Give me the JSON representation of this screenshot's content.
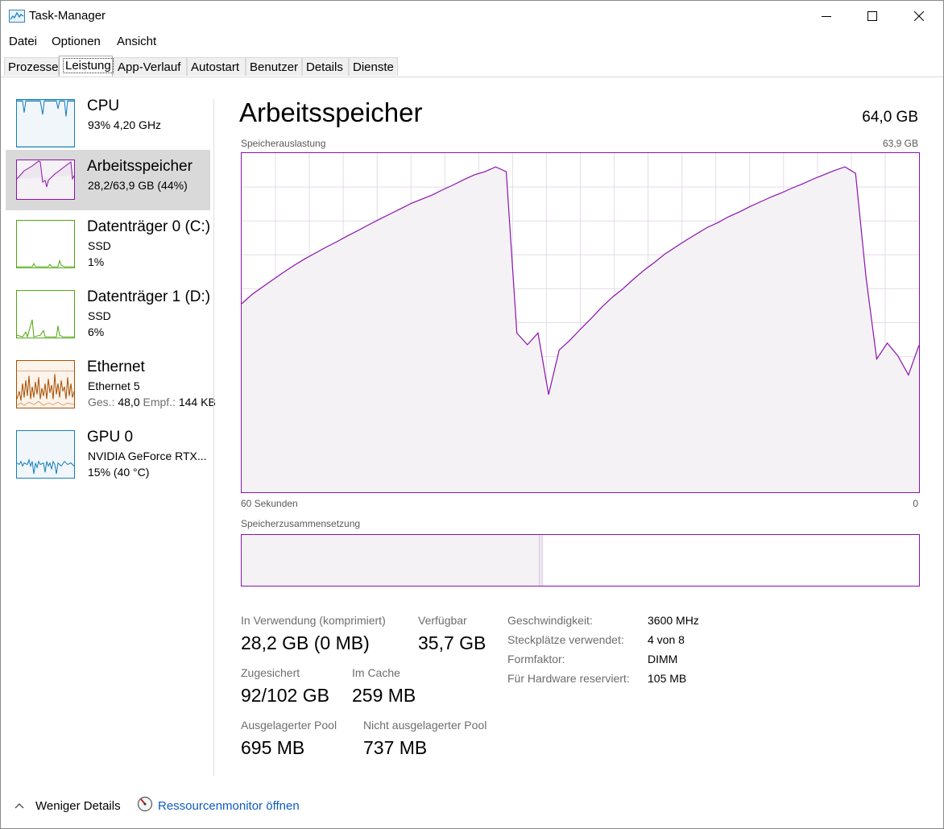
{
  "window": {
    "title": "Task-Manager"
  },
  "menu": [
    {
      "label": "Datei"
    },
    {
      "label": "Optionen"
    },
    {
      "label": "Ansicht"
    }
  ],
  "tabs": [
    {
      "label": "Prozesse"
    },
    {
      "label": "Leistung",
      "active": true
    },
    {
      "label": "App-Verlauf"
    },
    {
      "label": "Autostart"
    },
    {
      "label": "Benutzer"
    },
    {
      "label": "Details"
    },
    {
      "label": "Dienste"
    }
  ],
  "sidebar": {
    "items": [
      {
        "title": "CPU",
        "sub1": "93%  4,20 GHz",
        "color": "#117dbb"
      },
      {
        "title": "Arbeitsspeicher",
        "sub1": "28,2/63,9 GB (44%)",
        "color": "#8b12ae",
        "selected": true
      },
      {
        "title": "Datenträger 0 (C:)",
        "sub1": "SSD",
        "sub2": "1%",
        "color": "#4da60c"
      },
      {
        "title": "Datenträger 1 (D:)",
        "sub1": "SSD",
        "sub2": "6%",
        "color": "#4da60c"
      },
      {
        "title": "Ethernet",
        "sub1": "Ethernet 5",
        "sub2_label1": "Ges.:",
        "sub2_value1": "48,0",
        "sub2_label2": "Empf.:",
        "sub2_value2": "144 KB",
        "color": "#a74f01"
      },
      {
        "title": "GPU 0",
        "sub1": "NVIDIA GeForce RTX...",
        "sub2": "15%  (40 °C)",
        "color": "#117dbb"
      }
    ]
  },
  "main": {
    "title": "Arbeitsspeicher",
    "total": "64,0 GB",
    "usage_label": "Speicherauslastung",
    "usage_max": "63,9 GB",
    "time_left": "60 Sekunden",
    "time_right": "0",
    "composition_label": "Speicherzusammensetzung",
    "composition_in_use_fraction": 0.44,
    "accent_color": "#8b12ae"
  },
  "stats": {
    "in_use_label": "In Verwendung (komprimiert)",
    "in_use_value": "28,2 GB (0 MB)",
    "available_label": "Verfügbar",
    "available_value": "35,7 GB",
    "committed_label": "Zugesichert",
    "committed_value": "92/102 GB",
    "cached_label": "Im Cache",
    "cached_value": "259 MB",
    "paged_label": "Ausgelagerter Pool",
    "paged_value": "695 MB",
    "nonpaged_label": "Nicht ausgelagerter Pool",
    "nonpaged_value": "737 MB"
  },
  "specs": [
    {
      "label": "Geschwindigkeit:",
      "value": "3600 MHz"
    },
    {
      "label": "Steckplätze verwendet:",
      "value": "4 von 8"
    },
    {
      "label": "Formfaktor:",
      "value": "DIMM"
    },
    {
      "label": "Für Hardware reserviert:",
      "value": "105 MB"
    }
  ],
  "footer": {
    "less_details": "Weniger Details",
    "resource_monitor": "Ressourcenmonitor öffnen"
  },
  "chart_data": {
    "type": "area",
    "x_range": [
      60,
      0
    ],
    "y_range": [
      0,
      63.9
    ],
    "values": [
      35.5,
      37.3,
      38.7,
      40.1,
      41.5,
      42.8,
      44.0,
      45.1,
      46.2,
      47.2,
      48.3,
      49.3,
      50.4,
      51.4,
      52.4,
      53.4,
      54.4,
      55.2,
      56.0,
      57.0,
      57.9,
      58.9,
      59.8,
      60.4,
      61.3,
      60.4,
      30.0,
      27.8,
      30.0,
      18.4,
      26.8,
      28.6,
      30.7,
      32.7,
      34.8,
      36.7,
      38.3,
      40.1,
      41.8,
      43.3,
      44.9,
      46.2,
      47.5,
      48.7,
      49.9,
      50.8,
      51.9,
      52.8,
      53.8,
      54.7,
      55.6,
      56.4,
      57.3,
      58.1,
      59.0,
      59.8,
      60.6,
      61.3,
      60.1,
      40.4,
      25.1,
      28.1,
      25.7,
      22.1,
      27.7
    ]
  }
}
